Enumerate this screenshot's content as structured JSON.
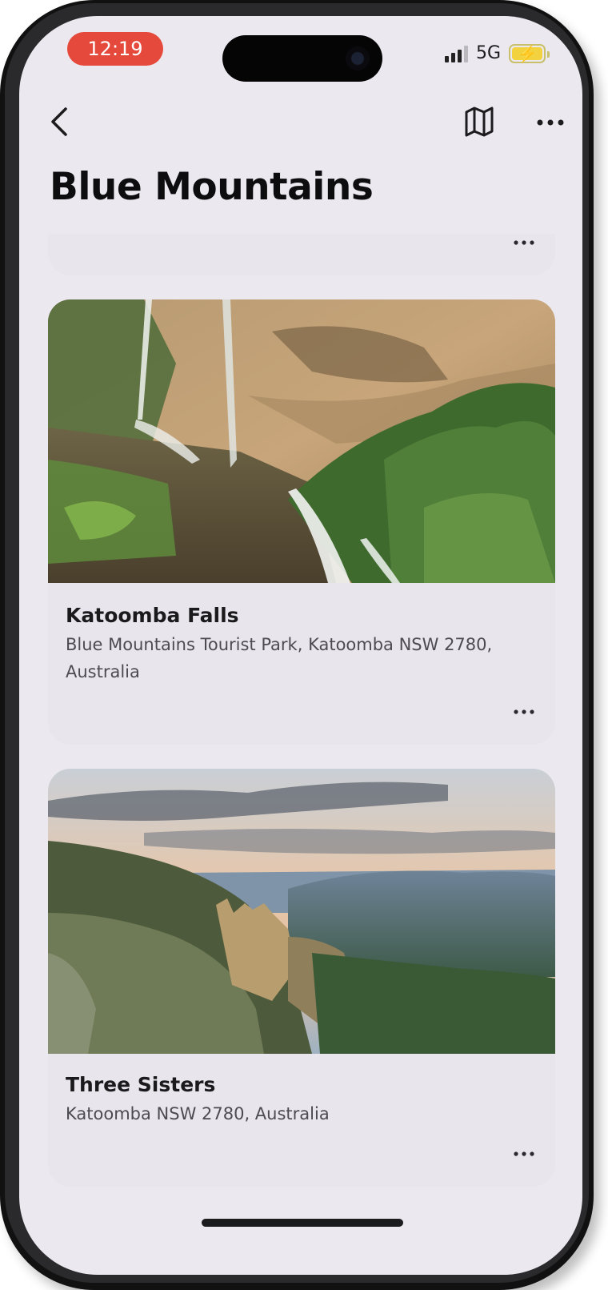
{
  "status_bar": {
    "time": "12:19",
    "network": "5G",
    "battery_state": "charging",
    "time_pill_color": "#e5493b"
  },
  "nav": {
    "back_icon": "chevron-left-icon",
    "map_icon": "map-icon",
    "more_icon": "ellipsis-icon"
  },
  "page": {
    "title": "Blue Mountains"
  },
  "places": [
    {
      "title": "Katoomba Falls",
      "address": "Blue Mountains Tourist Park, Katoomba NSW 2780, Australia"
    },
    {
      "title": "Three Sisters",
      "address": "Katoomba NSW 2780, Australia"
    }
  ],
  "colors": {
    "background": "#ebe9ef",
    "card": "#e8e6ec",
    "title_text": "#0d0d0f"
  }
}
